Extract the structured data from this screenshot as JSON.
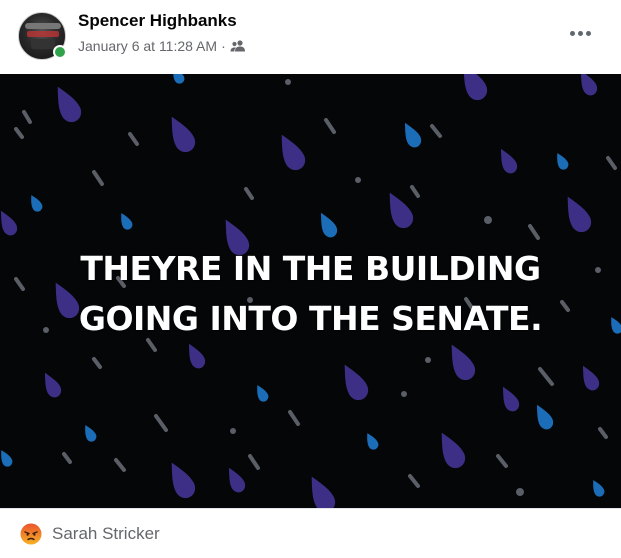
{
  "post": {
    "author": "Spencer Highbanks",
    "timestamp": "January 6 at 11:28 AM",
    "separator": "·",
    "audience_icon": "friends-icon",
    "menu_icon": "more-options-icon",
    "body_text_line1": "THEYRE IN THE BUILDING",
    "body_text_line2": "GOING INTO THE SENATE.",
    "background_style": "raindrops",
    "colors": {
      "background": "#050608",
      "drop_purple": "#3d2f85",
      "drop_blue": "#1c6db8",
      "drop_gray": "#5a5e66",
      "online": "#31a24c"
    }
  },
  "reactions": {
    "icon": "angry-reaction-icon",
    "reactor": "Sarah Stricker"
  }
}
